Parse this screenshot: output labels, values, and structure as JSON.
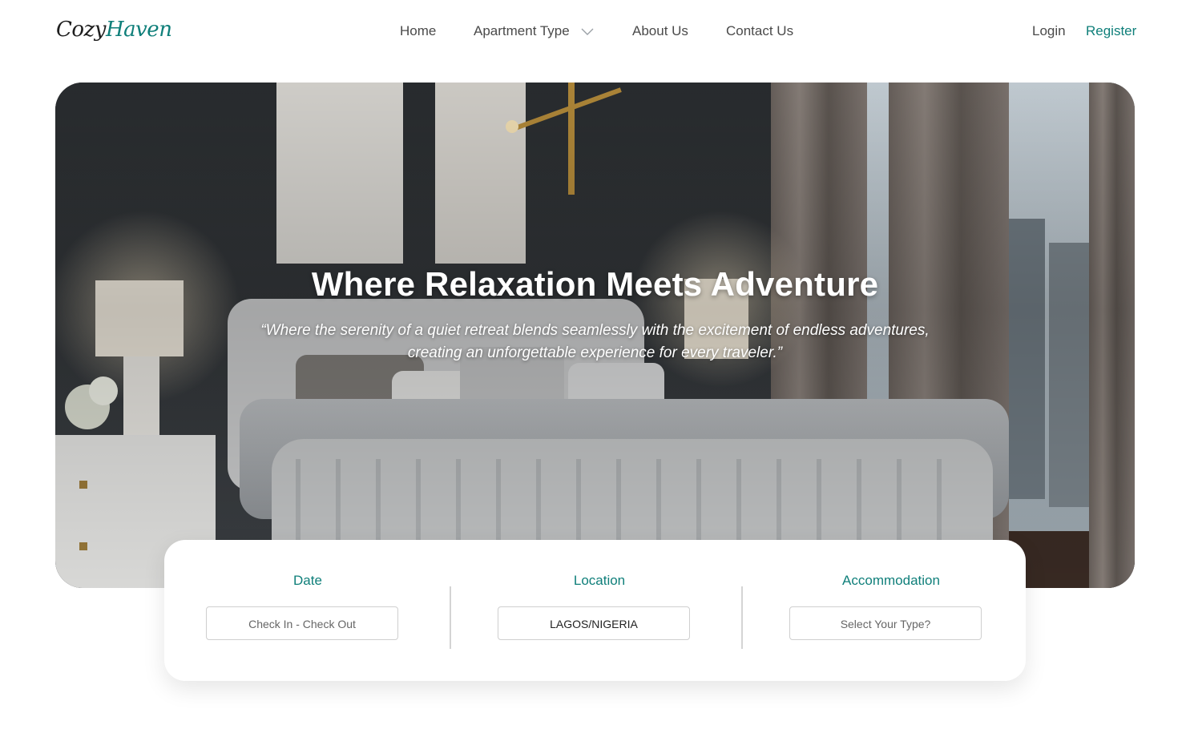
{
  "brand": {
    "part1": "Cozy",
    "part2": "Haven"
  },
  "nav": {
    "items": [
      "Home",
      "Apartment Type",
      "About Us",
      "Contact Us"
    ],
    "dropdown_icon": "chevron-down-icon"
  },
  "auth": {
    "login": "Login",
    "register": "Register"
  },
  "hero": {
    "title": "Where Relaxation Meets Adventure",
    "quote": "“Where the serenity of a quiet retreat blends seamlessly with the excitement of endless adventures, creating an unforgettable experience for every traveler.”"
  },
  "booking": {
    "date": {
      "label": "Date",
      "value": "Check In - Check Out"
    },
    "location": {
      "label": "Location",
      "value": "LAGOS/NIGERIA"
    },
    "accommodation": {
      "label": "Accommodation",
      "value": "Select Your Type?"
    }
  },
  "colors": {
    "accent": "#0f7f7a",
    "text": "#4a4a4a"
  }
}
